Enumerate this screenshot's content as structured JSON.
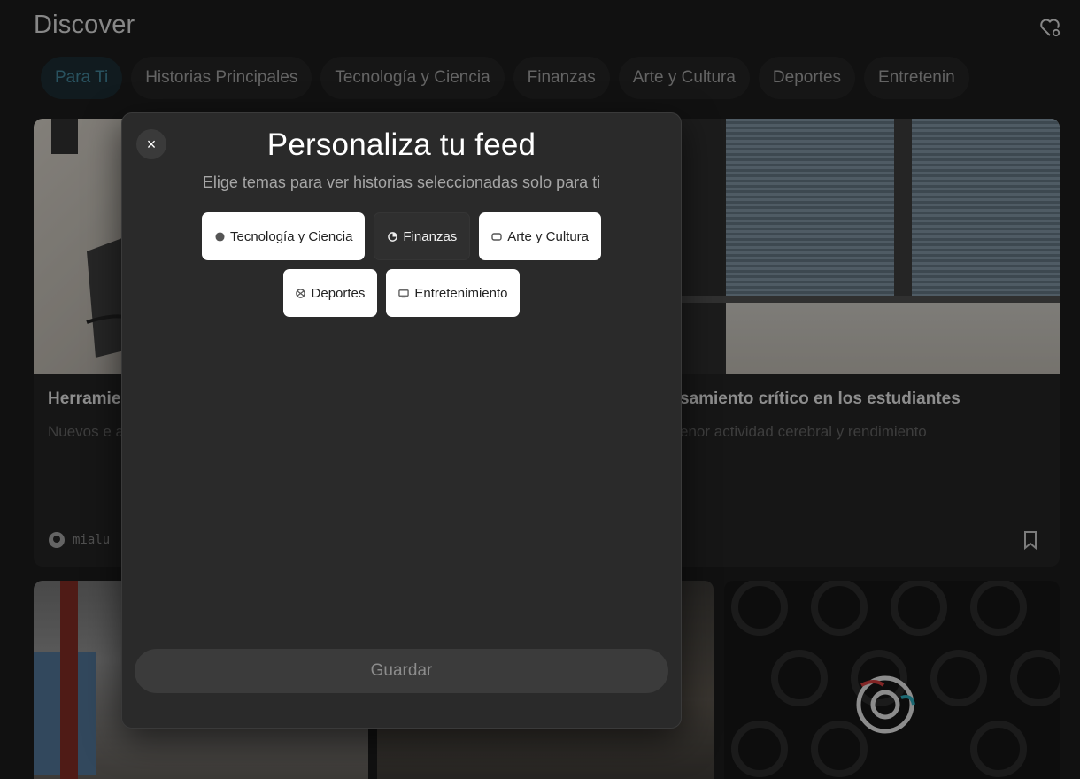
{
  "header": {
    "title": "Discover",
    "heart_icon": "heart-settings-icon"
  },
  "tabs": [
    {
      "label": "Para Ti",
      "active": true
    },
    {
      "label": "Historias Principales",
      "active": false
    },
    {
      "label": "Tecnología y Ciencia",
      "active": false
    },
    {
      "label": "Finanzas",
      "active": false
    },
    {
      "label": "Arte y Cultura",
      "active": false
    },
    {
      "label": "Deportes",
      "active": false
    },
    {
      "label": "Entretenin",
      "active": false
    }
  ],
  "cards": {
    "top_left": {
      "title": "Herramie",
      "description": "Nuevos e académic",
      "source": "mialu"
    },
    "top_right": {
      "title": "samiento crítico en los estudiantes",
      "description": "enor actividad cerebral y rendimiento"
    }
  },
  "modal": {
    "title": "Personaliza tu feed",
    "subtitle": "Elige temas para ver historias seleccionadas solo para ti",
    "close_label": "×",
    "topics": [
      {
        "label": "Tecnología y Ciencia",
        "selected": true,
        "icon": "globe-icon"
      },
      {
        "label": "Finanzas",
        "selected": false,
        "icon": "pie-chart-icon"
      },
      {
        "label": "Arte y Cultura",
        "selected": true,
        "icon": "palette-icon"
      },
      {
        "label": "Deportes",
        "selected": true,
        "icon": "ball-icon"
      },
      {
        "label": "Entretenimiento",
        "selected": true,
        "icon": "tv-icon"
      }
    ],
    "save_label": "Guardar"
  },
  "colors": {
    "active_tab_text": "#3f7f93",
    "modal_bg": "#2a2a2a",
    "chip_selected_bg": "#ffffff"
  }
}
